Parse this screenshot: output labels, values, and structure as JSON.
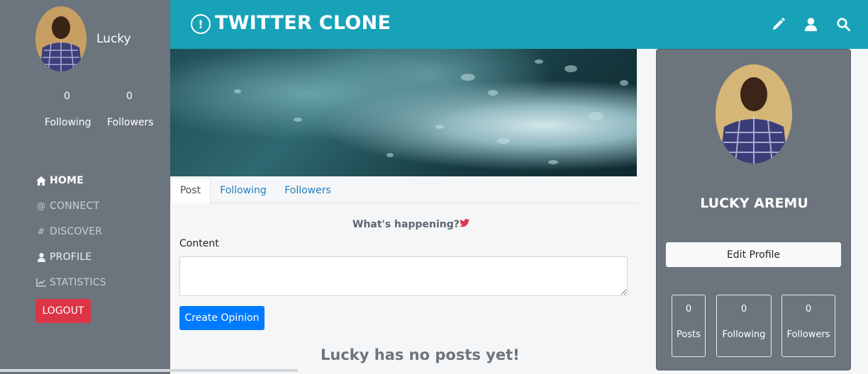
{
  "sidebar": {
    "user_name": "Lucky",
    "stats": [
      {
        "value": "0",
        "label": "Following"
      },
      {
        "value": "0",
        "label": "Followers"
      }
    ],
    "nav": [
      {
        "label": "HOME",
        "icon": "home-icon",
        "active": true
      },
      {
        "label": "CONNECT",
        "icon": "at-icon",
        "active": false
      },
      {
        "label": "DISCOVER",
        "icon": "hash-icon",
        "active": false
      },
      {
        "label": "PROFILE",
        "icon": "user-icon",
        "active": false
      },
      {
        "label": "STATISTICS",
        "icon": "chart-line-icon",
        "active": false
      }
    ],
    "logout_label": "LOGOUT"
  },
  "header": {
    "brand": "TWITTER CLONE",
    "icons": [
      "pencil-icon",
      "user-icon",
      "search-icon"
    ]
  },
  "main": {
    "tabs": [
      {
        "label": "Post",
        "active": true
      },
      {
        "label": "Following",
        "active": false
      },
      {
        "label": "Followers",
        "active": false
      }
    ],
    "prompt": "What's happening?",
    "content_label": "Content",
    "content_value": "",
    "create_button": "Create Opinion",
    "empty_message": "Lucky has no posts yet!"
  },
  "profile_card": {
    "full_name": "LUCKY AREMU",
    "edit_button": "Edit Profile",
    "stats": [
      {
        "value": "0",
        "label": "Posts"
      },
      {
        "value": "0",
        "label": "Following"
      },
      {
        "value": "0",
        "label": "Followers"
      }
    ]
  },
  "colors": {
    "header": "#17a2b8",
    "sidebar": "#6c757d",
    "logout": "#dc3545",
    "primary": "#007bff",
    "twitter_bird": "#e0344f"
  }
}
